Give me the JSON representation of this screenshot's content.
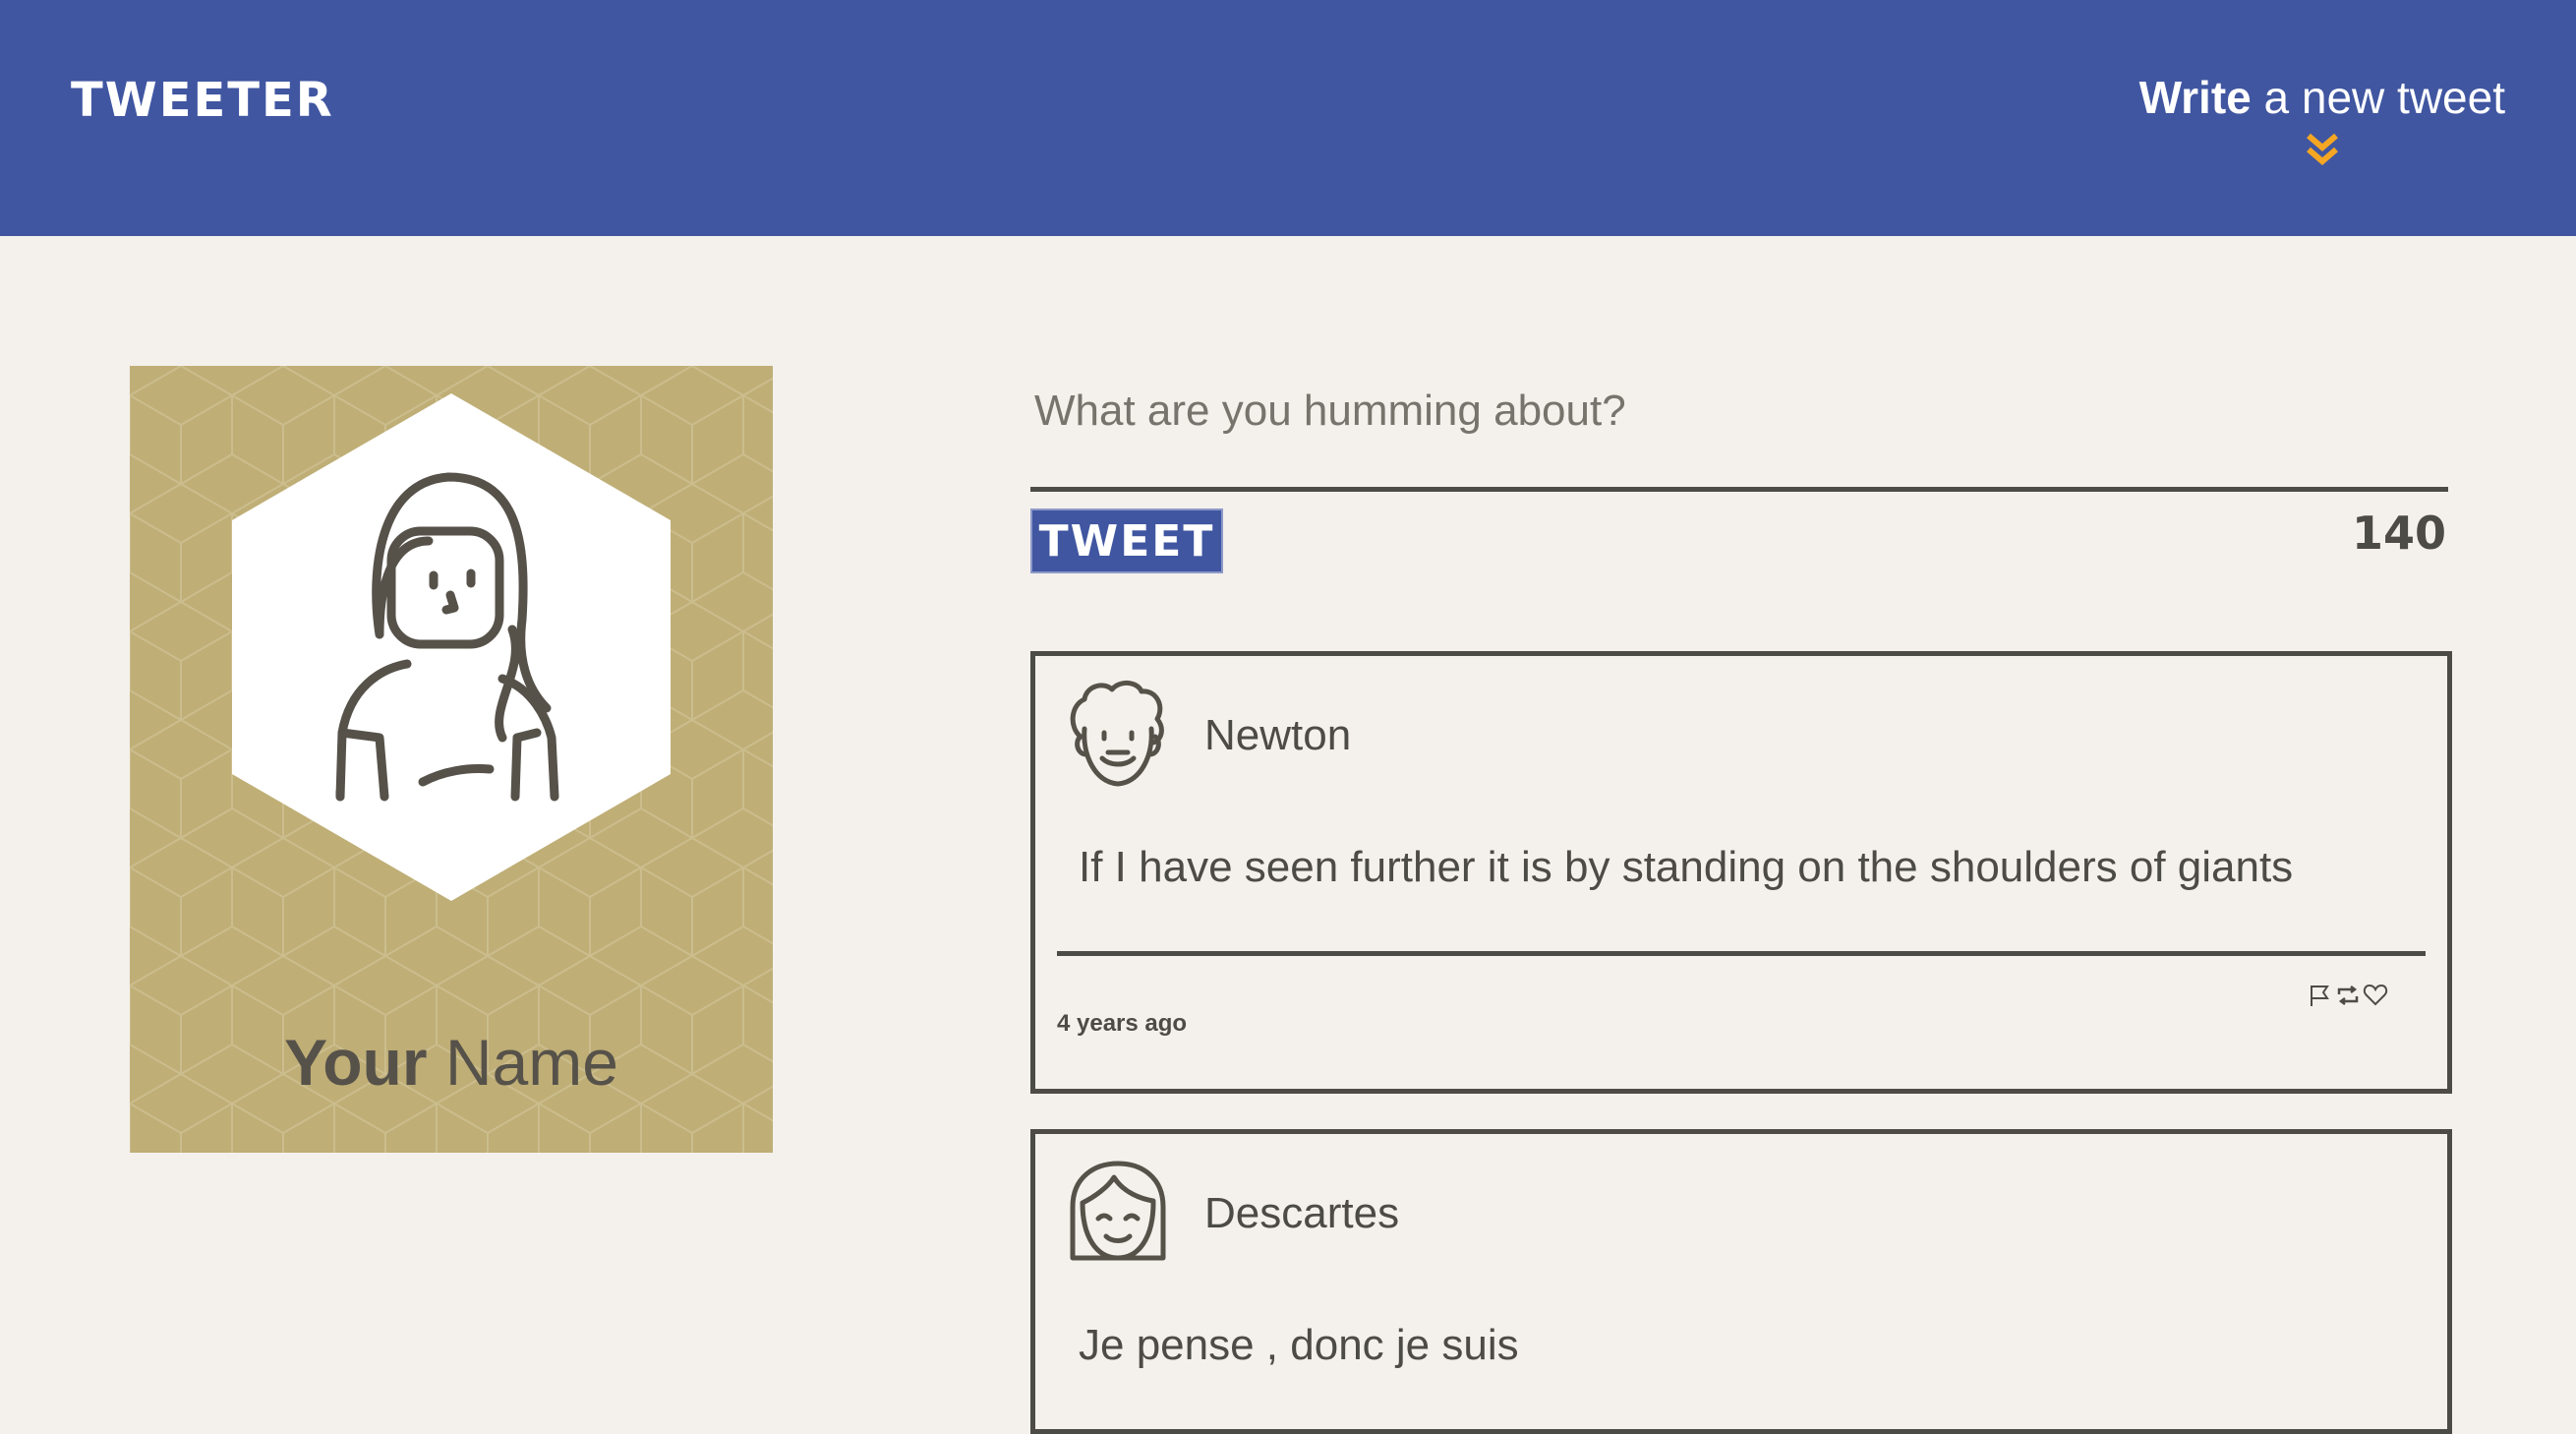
{
  "nav": {
    "logo": "Tweeter",
    "compose_bold": "Write",
    "compose_light": " a new tweet",
    "compose_icon": "double-chevron-down-icon",
    "accent_color": "#f5a623"
  },
  "profile": {
    "first_name": "Your",
    "last_name": " Name",
    "avatar_icon": "girl-avatar-icon",
    "card_color": "#bfae76"
  },
  "compose": {
    "placeholder": "What are you humming about?",
    "button_label": "TWEET",
    "counter": "140"
  },
  "tweets": [
    {
      "author": "Newton",
      "avatar_icon": "curly-hair-man-avatar-icon",
      "content": "If I have seen further it is by standing on the shoulders of giants",
      "time": "4 years ago",
      "actions": [
        "flag-icon",
        "retweet-icon",
        "heart-icon"
      ]
    },
    {
      "author": "Descartes",
      "avatar_icon": "bob-hair-avatar-icon",
      "content": "Je pense , donc je suis"
    }
  ],
  "colors": {
    "header": "#4056a1",
    "background": "#f4f1ec",
    "text": "#4d4b45"
  }
}
